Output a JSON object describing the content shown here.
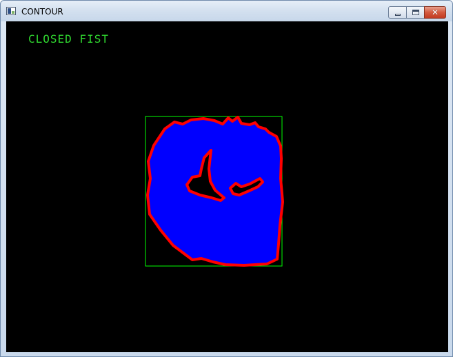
{
  "window": {
    "title": "CONTOUR",
    "icon": "app-window-icon",
    "controls": {
      "minimize": "minimize-icon",
      "maximize": "maximize-icon",
      "close": "close-icon",
      "close_glyph": "✕"
    }
  },
  "canvas": {
    "background": "#000000",
    "gesture_label": "CLOSED FIST",
    "label_color": "#2fd62f",
    "hand_fill_color": "#0000ff",
    "contour_color": "#ff0000",
    "bounding_box_color": "#00ff00"
  }
}
